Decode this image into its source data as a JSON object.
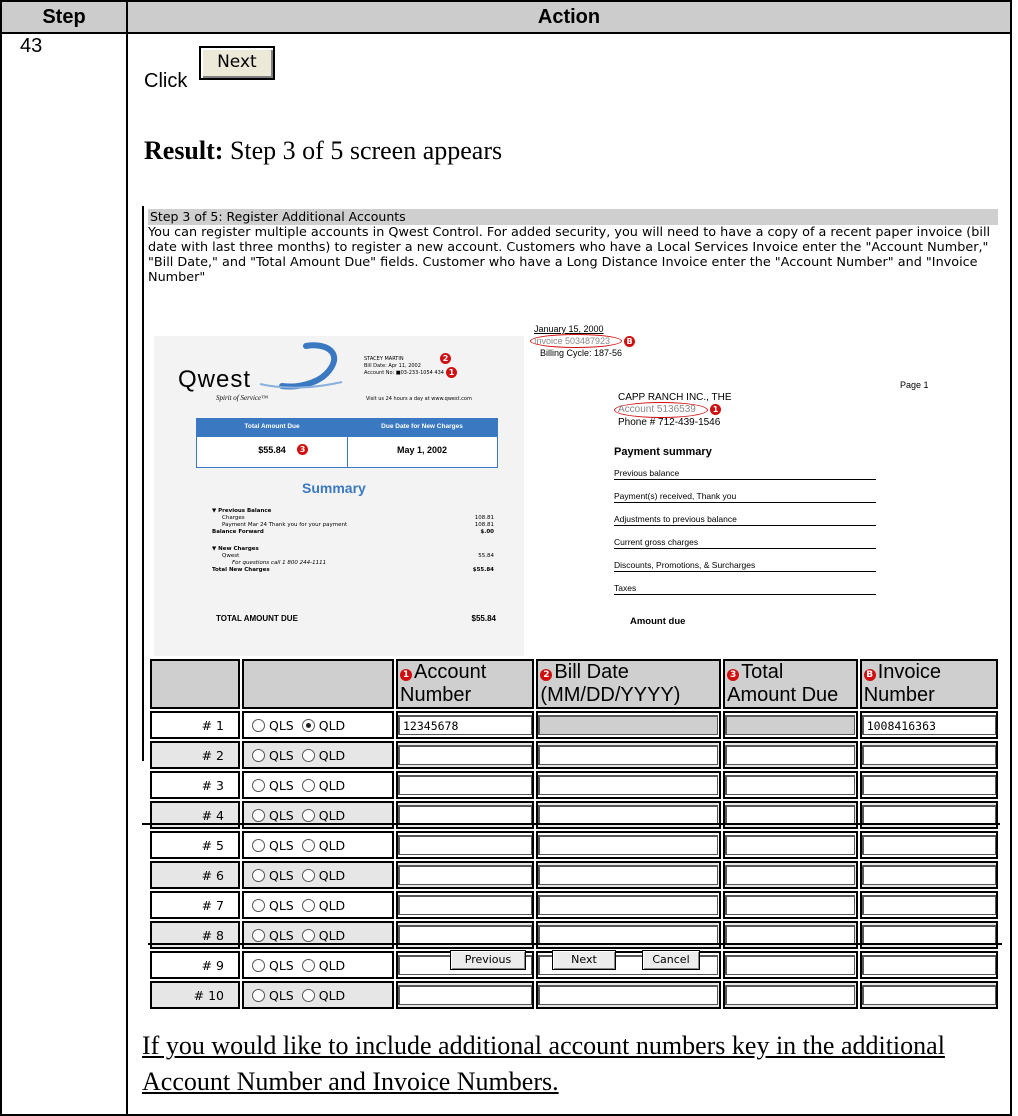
{
  "table_header": {
    "step": "Step",
    "action": "Action"
  },
  "step_number": "43",
  "click_text": "Click",
  "next_button_image_label": "Next",
  "result": {
    "label": "Result:",
    "text": "Step 3 of 5 screen appears"
  },
  "screen": {
    "title": "Step 3 of 5: Register Additional Accounts",
    "intro": "You can register multiple accounts in Qwest Control. For added security, you will need to have a copy of a recent paper invoice (bill date with last three months) to register a new account. Customers who have a Local Services Invoice enter the \"Account Number,\" \"Bill Date,\" and \"Total Amount Due\" fields. Customer who have a Long Distance Invoice enter the \"Account Number\" and \"Invoice Number\"",
    "bill": {
      "logo": "Qwest",
      "tagline": "Spirit of Service™",
      "name": "STACEY MARTIN",
      "bill_date": "Bill Date:     Apr 11, 2002",
      "account_no": "Account No:  ■03-233-1054 434",
      "visit": "Visit us 24 hours a day at www.qwest.com",
      "total_amount_due_label": "Total Amount Due",
      "due_date_label": "Due Date for New Charges",
      "total_amount_due": "$55.84",
      "due_date": "May 1, 2002",
      "summary_title": "Summary",
      "previous_balance": "▼ Previous Balance",
      "charges": "Charges",
      "charges_amount": "108.81",
      "payment": "Payment          Mar 24     Thank you for your payment",
      "payment_amount": "108.81",
      "balance_forward": "Balance Forward",
      "balance_forward_amount": "$.00",
      "new_charges": "▼ New Charges",
      "qwest": "Qwest",
      "qwest_amount": "55.84",
      "questions": "For questions call 1 800 244-1111",
      "total_new_charges": "Total New Charges",
      "total_new_charges_amount": "$55.84",
      "total_amount_due_caps": "TOTAL AMOUNT DUE",
      "total_amount_due_caps_value": "$55.84"
    },
    "invoice": {
      "date": "January 15, 2000",
      "invoice_number": "Invoice 503487923",
      "billing_cycle": "Billing Cycle: 187-56",
      "page": "Page 1",
      "company": "CAPP RANCH INC., THE",
      "account": "Account  5136539",
      "phone": "Phone # 712-439-1546",
      "payment_summary": "Payment summary",
      "rows": [
        "Previous balance",
        "Payment(s) received, Thank you",
        "Adjustments to previous balance",
        "Current gross charges",
        "Discounts, Promotions, & Surcharges",
        "Taxes"
      ],
      "amount_due": "Amount due"
    },
    "badges": {
      "one": "1",
      "two": "2",
      "three": "3",
      "b": "B"
    },
    "table": {
      "headers": {
        "account_number": "Account Number",
        "bill_date": "Bill Date (MM/DD/YYYY)",
        "total_amount_due": "Total Amount Due",
        "invoice_number": "Invoice Number"
      },
      "qls_label": "QLS",
      "qld_label": "QLD",
      "rows": [
        {
          "num": "# 1",
          "selected": "QLD",
          "account": "12345678",
          "invoice": "1008416363"
        },
        {
          "num": "# 2",
          "selected": "",
          "account": "",
          "invoice": ""
        },
        {
          "num": "# 3",
          "selected": "",
          "account": "",
          "invoice": ""
        },
        {
          "num": "# 4",
          "selected": "",
          "account": "",
          "invoice": ""
        },
        {
          "num": "# 5",
          "selected": "",
          "account": "",
          "invoice": ""
        },
        {
          "num": "# 6",
          "selected": "",
          "account": "",
          "invoice": ""
        },
        {
          "num": "# 7",
          "selected": "",
          "account": "",
          "invoice": ""
        },
        {
          "num": "# 8",
          "selected": "",
          "account": "",
          "invoice": ""
        },
        {
          "num": "# 9",
          "selected": "",
          "account": "",
          "invoice": ""
        },
        {
          "num": "# 10",
          "selected": "",
          "account": "",
          "invoice": ""
        }
      ]
    },
    "buttons": {
      "previous": "Previous",
      "next": "Next",
      "cancel": "Cancel"
    }
  },
  "footer_note": "If you would like to include additional account numbers key in the additional Account Number and Invoice Numbers."
}
